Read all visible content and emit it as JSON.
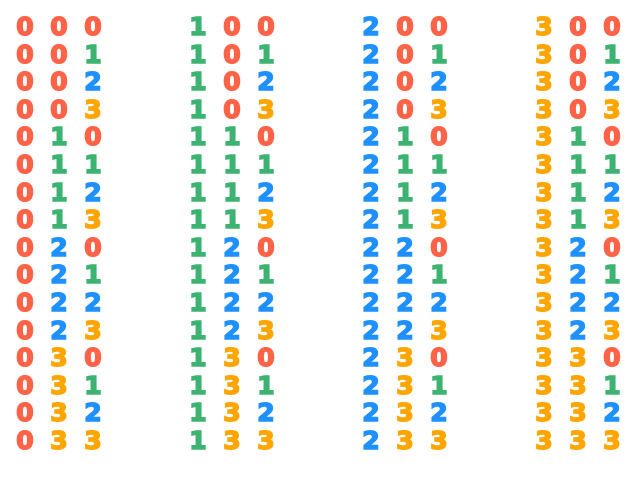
{
  "digit_colors": {
    "0": "#ff6347",
    "1": "#3cb371",
    "2": "#1e90ff",
    "3": "#ffa500"
  },
  "columns": [
    {
      "first": "0",
      "rows": [
        [
          "0",
          "0",
          "0"
        ],
        [
          "0",
          "0",
          "1"
        ],
        [
          "0",
          "0",
          "2"
        ],
        [
          "0",
          "0",
          "3"
        ],
        [
          "0",
          "1",
          "0"
        ],
        [
          "0",
          "1",
          "1"
        ],
        [
          "0",
          "1",
          "2"
        ],
        [
          "0",
          "1",
          "3"
        ],
        [
          "0",
          "2",
          "0"
        ],
        [
          "0",
          "2",
          "1"
        ],
        [
          "0",
          "2",
          "2"
        ],
        [
          "0",
          "2",
          "3"
        ],
        [
          "0",
          "3",
          "0"
        ],
        [
          "0",
          "3",
          "1"
        ],
        [
          "0",
          "3",
          "2"
        ],
        [
          "0",
          "3",
          "3"
        ]
      ]
    },
    {
      "first": "1",
      "rows": [
        [
          "1",
          "0",
          "0"
        ],
        [
          "1",
          "0",
          "1"
        ],
        [
          "1",
          "0",
          "2"
        ],
        [
          "1",
          "0",
          "3"
        ],
        [
          "1",
          "1",
          "0"
        ],
        [
          "1",
          "1",
          "1"
        ],
        [
          "1",
          "1",
          "2"
        ],
        [
          "1",
          "1",
          "3"
        ],
        [
          "1",
          "2",
          "0"
        ],
        [
          "1",
          "2",
          "1"
        ],
        [
          "1",
          "2",
          "2"
        ],
        [
          "1",
          "2",
          "3"
        ],
        [
          "1",
          "3",
          "0"
        ],
        [
          "1",
          "3",
          "1"
        ],
        [
          "1",
          "3",
          "2"
        ],
        [
          "1",
          "3",
          "3"
        ]
      ]
    },
    {
      "first": "2",
      "rows": [
        [
          "2",
          "0",
          "0"
        ],
        [
          "2",
          "0",
          "1"
        ],
        [
          "2",
          "0",
          "2"
        ],
        [
          "2",
          "0",
          "3"
        ],
        [
          "2",
          "1",
          "0"
        ],
        [
          "2",
          "1",
          "1"
        ],
        [
          "2",
          "1",
          "2"
        ],
        [
          "2",
          "1",
          "3"
        ],
        [
          "2",
          "2",
          "0"
        ],
        [
          "2",
          "2",
          "1"
        ],
        [
          "2",
          "2",
          "2"
        ],
        [
          "2",
          "2",
          "3"
        ],
        [
          "2",
          "3",
          "0"
        ],
        [
          "2",
          "3",
          "1"
        ],
        [
          "2",
          "3",
          "2"
        ],
        [
          "2",
          "3",
          "3"
        ]
      ]
    },
    {
      "first": "3",
      "rows": [
        [
          "3",
          "0",
          "0"
        ],
        [
          "3",
          "0",
          "1"
        ],
        [
          "3",
          "0",
          "2"
        ],
        [
          "3",
          "0",
          "3"
        ],
        [
          "3",
          "1",
          "0"
        ],
        [
          "3",
          "1",
          "1"
        ],
        [
          "3",
          "1",
          "2"
        ],
        [
          "3",
          "1",
          "3"
        ],
        [
          "3",
          "2",
          "0"
        ],
        [
          "3",
          "2",
          "1"
        ],
        [
          "3",
          "2",
          "2"
        ],
        [
          "3",
          "2",
          "3"
        ],
        [
          "3",
          "3",
          "0"
        ],
        [
          "3",
          "3",
          "1"
        ],
        [
          "3",
          "3",
          "2"
        ],
        [
          "3",
          "3",
          "3"
        ]
      ]
    }
  ]
}
